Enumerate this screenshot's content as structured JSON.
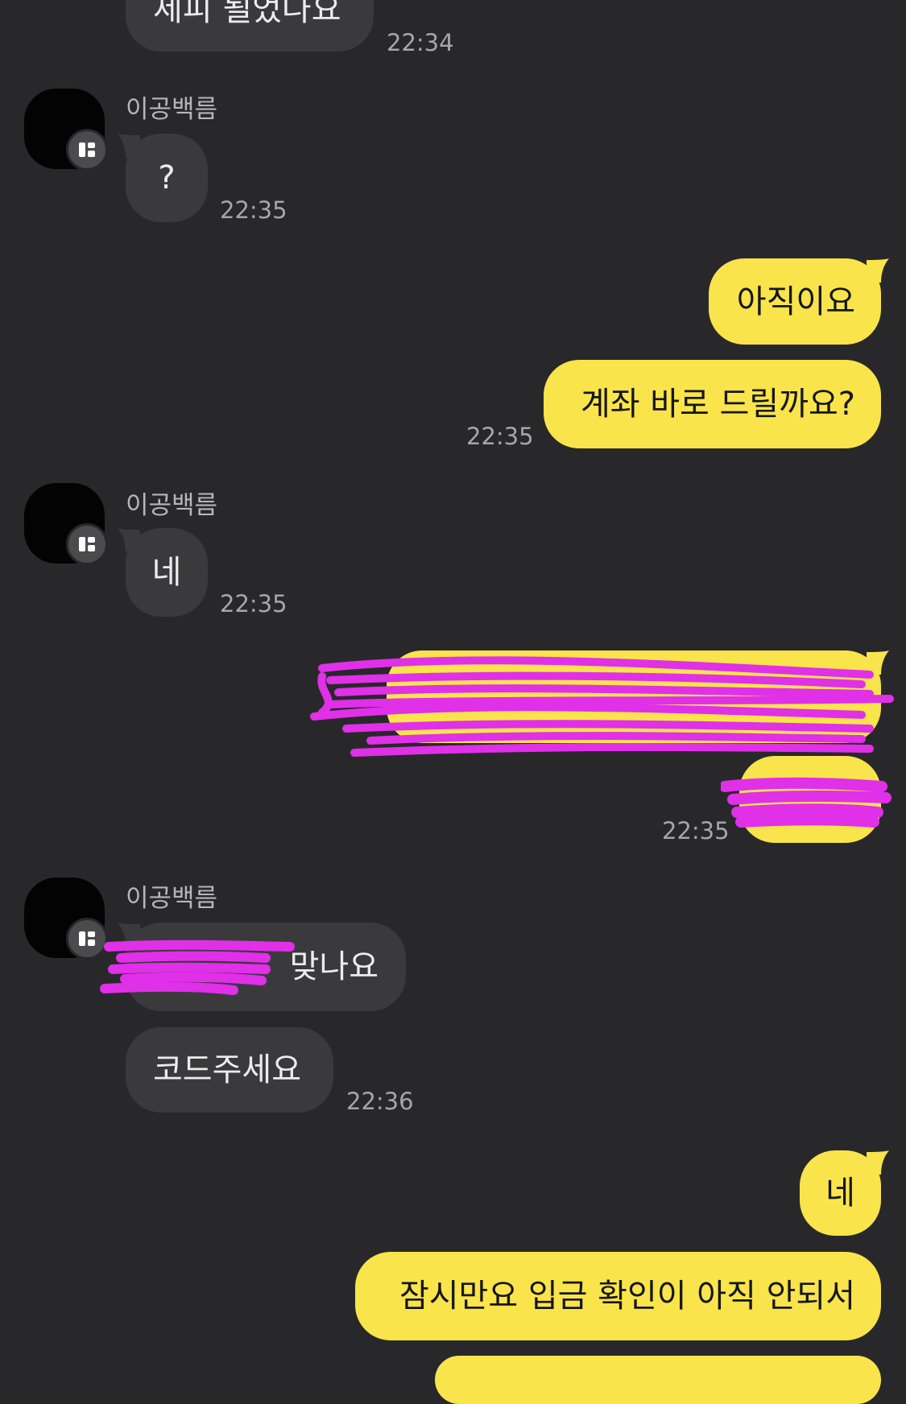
{
  "chat": {
    "sender_name": "이공백름",
    "messages": [
      {
        "id": "m0",
        "text": "세피 될었나요",
        "time": "22:34"
      },
      {
        "id": "m1",
        "text": "?",
        "time": "22:35"
      },
      {
        "id": "m2",
        "text": "아직이요"
      },
      {
        "id": "m3",
        "text": "계좌 바로 드릴까요?",
        "time": "22:35"
      },
      {
        "id": "m4",
        "text": "네",
        "time": "22:35"
      },
      {
        "id": "m7",
        "text": "맞나요"
      },
      {
        "id": "m8",
        "text": "코드주세요",
        "time": "22:36"
      },
      {
        "id": "m9",
        "text": "네"
      },
      {
        "id": "m10",
        "text": "잠시만요 입금 확인이 아직 안되서"
      }
    ],
    "redacted_time": "22:35"
  },
  "colors": {
    "background": "#28282a",
    "incoming_bubble": "#3a3a3c",
    "outgoing_bubble": "#f9e44b",
    "redaction_scribble": "#e030e8"
  },
  "icons": {
    "avatar_badge": "talk-channel-icon"
  }
}
